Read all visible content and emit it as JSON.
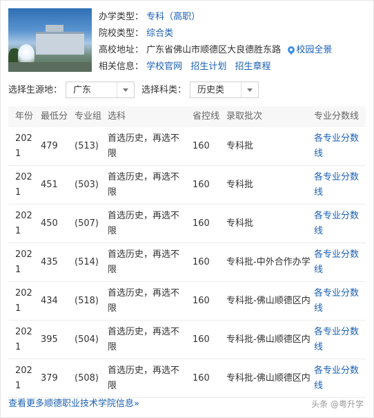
{
  "school_info": {
    "type_label": "办学类型：",
    "type_value": "专科（高职）",
    "category_label": "院校类型：",
    "category_value": "综合类",
    "address_label": "高校地址：",
    "address_value": "广东省佛山市顺德区大良德胜东路",
    "tour_link": "校园全景",
    "related_label": "相关信息：",
    "related_links": [
      "学校官网",
      "招生计划",
      "招生章程"
    ]
  },
  "filters": {
    "origin_label": "选择生源地：",
    "origin_value": "广东",
    "subject_label": "选择科类：",
    "subject_value": "历史类"
  },
  "table": {
    "headers": [
      "年份",
      "最低分",
      "专业组",
      "选科",
      "省控线",
      "录取批次",
      "专业分数线"
    ],
    "rows": [
      {
        "year": "2021",
        "min": "479",
        "group": "(513)",
        "subject": "首选历史，再选不限",
        "prov": "160",
        "batch": "专科批",
        "link": "各专业分数线"
      },
      {
        "year": "2021",
        "min": "451",
        "group": "(503)",
        "subject": "首选历史，再选不限",
        "prov": "160",
        "batch": "专科批",
        "link": "各专业分数线"
      },
      {
        "year": "2021",
        "min": "450",
        "group": "(507)",
        "subject": "首选历史，再选不限",
        "prov": "160",
        "batch": "专科批",
        "link": "各专业分数线"
      },
      {
        "year": "2021",
        "min": "435",
        "group": "(514)",
        "subject": "首选历史，再选不限",
        "prov": "160",
        "batch": "专科批-中外合作办学",
        "link": "各专业分数线"
      },
      {
        "year": "2021",
        "min": "434",
        "group": "(518)",
        "subject": "首选历史，再选不限",
        "prov": "160",
        "batch": "专科批-佛山顺德区内",
        "link": "各专业分数线"
      },
      {
        "year": "2021",
        "min": "395",
        "group": "(504)",
        "subject": "首选历史，再选不限",
        "prov": "160",
        "batch": "专科批-佛山顺德区内",
        "link": "各专业分数线"
      },
      {
        "year": "2021",
        "min": "379",
        "group": "(508)",
        "subject": "首选历史，再选不限",
        "prov": "160",
        "batch": "专科批-佛山顺德区内",
        "link": "各专业分数线"
      }
    ]
  },
  "footer": {
    "more_link": "查看更多顺德职业技术学院信息»",
    "watermark": "头条 @粤升学"
  },
  "icons": {
    "campus_photo": "campus-photo",
    "location_pin": "location-pin-icon",
    "dropdown": "chevron-down-icon"
  },
  "colors": {
    "link": "#1a5fb4",
    "header_bg": "#f7f7f7"
  }
}
